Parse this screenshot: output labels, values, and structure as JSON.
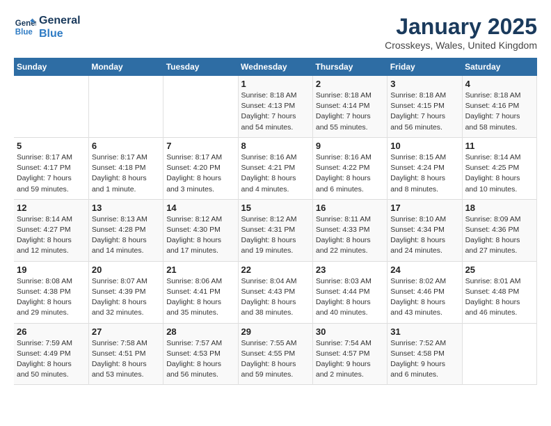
{
  "header": {
    "logo_line1": "General",
    "logo_line2": "Blue",
    "month_year": "January 2025",
    "location": "Crosskeys, Wales, United Kingdom"
  },
  "days_of_week": [
    "Sunday",
    "Monday",
    "Tuesday",
    "Wednesday",
    "Thursday",
    "Friday",
    "Saturday"
  ],
  "weeks": [
    {
      "days": [
        {
          "number": "",
          "info": ""
        },
        {
          "number": "",
          "info": ""
        },
        {
          "number": "",
          "info": ""
        },
        {
          "number": "1",
          "info": "Sunrise: 8:18 AM\nSunset: 4:13 PM\nDaylight: 7 hours\nand 54 minutes."
        },
        {
          "number": "2",
          "info": "Sunrise: 8:18 AM\nSunset: 4:14 PM\nDaylight: 7 hours\nand 55 minutes."
        },
        {
          "number": "3",
          "info": "Sunrise: 8:18 AM\nSunset: 4:15 PM\nDaylight: 7 hours\nand 56 minutes."
        },
        {
          "number": "4",
          "info": "Sunrise: 8:18 AM\nSunset: 4:16 PM\nDaylight: 7 hours\nand 58 minutes."
        }
      ]
    },
    {
      "days": [
        {
          "number": "5",
          "info": "Sunrise: 8:17 AM\nSunset: 4:17 PM\nDaylight: 7 hours\nand 59 minutes."
        },
        {
          "number": "6",
          "info": "Sunrise: 8:17 AM\nSunset: 4:18 PM\nDaylight: 8 hours\nand 1 minute."
        },
        {
          "number": "7",
          "info": "Sunrise: 8:17 AM\nSunset: 4:20 PM\nDaylight: 8 hours\nand 3 minutes."
        },
        {
          "number": "8",
          "info": "Sunrise: 8:16 AM\nSunset: 4:21 PM\nDaylight: 8 hours\nand 4 minutes."
        },
        {
          "number": "9",
          "info": "Sunrise: 8:16 AM\nSunset: 4:22 PM\nDaylight: 8 hours\nand 6 minutes."
        },
        {
          "number": "10",
          "info": "Sunrise: 8:15 AM\nSunset: 4:24 PM\nDaylight: 8 hours\nand 8 minutes."
        },
        {
          "number": "11",
          "info": "Sunrise: 8:14 AM\nSunset: 4:25 PM\nDaylight: 8 hours\nand 10 minutes."
        }
      ]
    },
    {
      "days": [
        {
          "number": "12",
          "info": "Sunrise: 8:14 AM\nSunset: 4:27 PM\nDaylight: 8 hours\nand 12 minutes."
        },
        {
          "number": "13",
          "info": "Sunrise: 8:13 AM\nSunset: 4:28 PM\nDaylight: 8 hours\nand 14 minutes."
        },
        {
          "number": "14",
          "info": "Sunrise: 8:12 AM\nSunset: 4:30 PM\nDaylight: 8 hours\nand 17 minutes."
        },
        {
          "number": "15",
          "info": "Sunrise: 8:12 AM\nSunset: 4:31 PM\nDaylight: 8 hours\nand 19 minutes."
        },
        {
          "number": "16",
          "info": "Sunrise: 8:11 AM\nSunset: 4:33 PM\nDaylight: 8 hours\nand 22 minutes."
        },
        {
          "number": "17",
          "info": "Sunrise: 8:10 AM\nSunset: 4:34 PM\nDaylight: 8 hours\nand 24 minutes."
        },
        {
          "number": "18",
          "info": "Sunrise: 8:09 AM\nSunset: 4:36 PM\nDaylight: 8 hours\nand 27 minutes."
        }
      ]
    },
    {
      "days": [
        {
          "number": "19",
          "info": "Sunrise: 8:08 AM\nSunset: 4:38 PM\nDaylight: 8 hours\nand 29 minutes."
        },
        {
          "number": "20",
          "info": "Sunrise: 8:07 AM\nSunset: 4:39 PM\nDaylight: 8 hours\nand 32 minutes."
        },
        {
          "number": "21",
          "info": "Sunrise: 8:06 AM\nSunset: 4:41 PM\nDaylight: 8 hours\nand 35 minutes."
        },
        {
          "number": "22",
          "info": "Sunrise: 8:04 AM\nSunset: 4:43 PM\nDaylight: 8 hours\nand 38 minutes."
        },
        {
          "number": "23",
          "info": "Sunrise: 8:03 AM\nSunset: 4:44 PM\nDaylight: 8 hours\nand 40 minutes."
        },
        {
          "number": "24",
          "info": "Sunrise: 8:02 AM\nSunset: 4:46 PM\nDaylight: 8 hours\nand 43 minutes."
        },
        {
          "number": "25",
          "info": "Sunrise: 8:01 AM\nSunset: 4:48 PM\nDaylight: 8 hours\nand 46 minutes."
        }
      ]
    },
    {
      "days": [
        {
          "number": "26",
          "info": "Sunrise: 7:59 AM\nSunset: 4:49 PM\nDaylight: 8 hours\nand 50 minutes."
        },
        {
          "number": "27",
          "info": "Sunrise: 7:58 AM\nSunset: 4:51 PM\nDaylight: 8 hours\nand 53 minutes."
        },
        {
          "number": "28",
          "info": "Sunrise: 7:57 AM\nSunset: 4:53 PM\nDaylight: 8 hours\nand 56 minutes."
        },
        {
          "number": "29",
          "info": "Sunrise: 7:55 AM\nSunset: 4:55 PM\nDaylight: 8 hours\nand 59 minutes."
        },
        {
          "number": "30",
          "info": "Sunrise: 7:54 AM\nSunset: 4:57 PM\nDaylight: 9 hours\nand 2 minutes."
        },
        {
          "number": "31",
          "info": "Sunrise: 7:52 AM\nSunset: 4:58 PM\nDaylight: 9 hours\nand 6 minutes."
        },
        {
          "number": "",
          "info": ""
        }
      ]
    }
  ]
}
